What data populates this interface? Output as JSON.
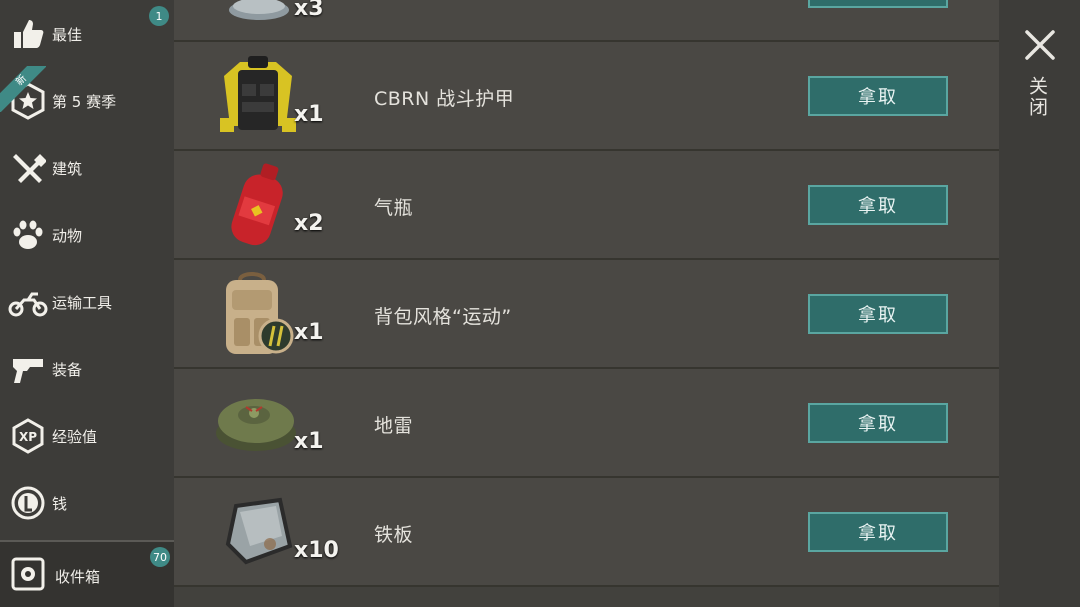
{
  "sidebar": {
    "items": [
      {
        "label": "最佳",
        "icon": "thumbs-up-icon",
        "badge": "1"
      },
      {
        "label": "第 5 赛季",
        "icon": "season-star-icon",
        "ribbon": "新"
      },
      {
        "label": "建筑",
        "icon": "hammer-wrench-icon"
      },
      {
        "label": "动物",
        "icon": "paw-icon"
      },
      {
        "label": "运输工具",
        "icon": "motorcycle-icon"
      },
      {
        "label": "装备",
        "icon": "pistol-icon"
      },
      {
        "label": "经验值",
        "icon": "xp-icon"
      },
      {
        "label": "钱",
        "icon": "coin-icon"
      }
    ],
    "storage": {
      "label": "收件箱",
      "icon": "safe-icon",
      "badge": "70"
    }
  },
  "list": {
    "partial_top": {
      "qty": "x3"
    },
    "items": [
      {
        "name": "CBRN 战斗护甲",
        "qty": "x1",
        "icon": "armor-vest-icon",
        "button": "拿取"
      },
      {
        "name": "气瓶",
        "qty": "x2",
        "icon": "gas-cylinder-icon",
        "button": "拿取"
      },
      {
        "name": "背包风格“运动”",
        "qty": "x1",
        "icon": "backpack-icon",
        "button": "拿取"
      },
      {
        "name": "地雷",
        "qty": "x1",
        "icon": "landmine-icon",
        "button": "拿取"
      },
      {
        "name": "铁板",
        "qty": "x10",
        "icon": "iron-plate-icon",
        "button": "拿取"
      }
    ]
  },
  "close": {
    "label": "关闭",
    "icon": "close-icon"
  },
  "colors": {
    "accent": "#2f6d6a",
    "accent_border": "#5aa6a1",
    "badge": "#3f8a86"
  }
}
